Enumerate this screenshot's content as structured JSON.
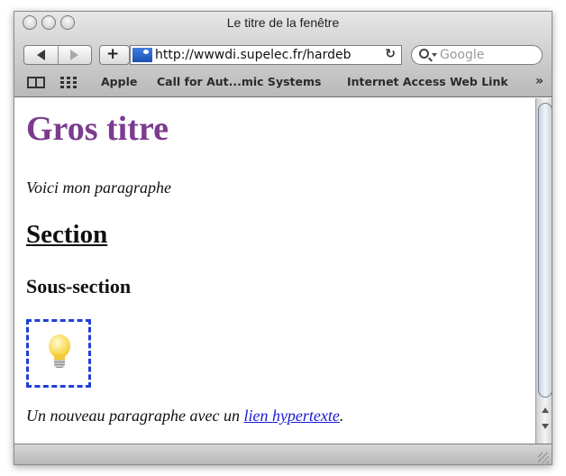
{
  "window": {
    "title": "Le titre de la fenêtre"
  },
  "toolbar": {
    "add_label": "+",
    "url": "http://wwwdi.supelec.fr/hardeb",
    "reload_icon": "↻",
    "search_placeholder": "Google"
  },
  "bookmarks": {
    "items": [
      {
        "label": "Apple"
      },
      {
        "label": "Call for Aut...mic Systems"
      },
      {
        "label": "Internet Access Web Link"
      }
    ],
    "more": "»"
  },
  "page": {
    "h1": "Gros titre",
    "p1": "Voici mon paragraphe",
    "h2": "Section",
    "h3": "Sous-section",
    "image_icon": "lightbulb-icon",
    "p2_before": "Un nouveau paragraphe avec un ",
    "p2_link": "lien hypertexte",
    "p2_after": "."
  },
  "colors": {
    "h1": "#7b3c8f",
    "link": "#1a1ad6",
    "image_border": "#1f3fd6"
  }
}
